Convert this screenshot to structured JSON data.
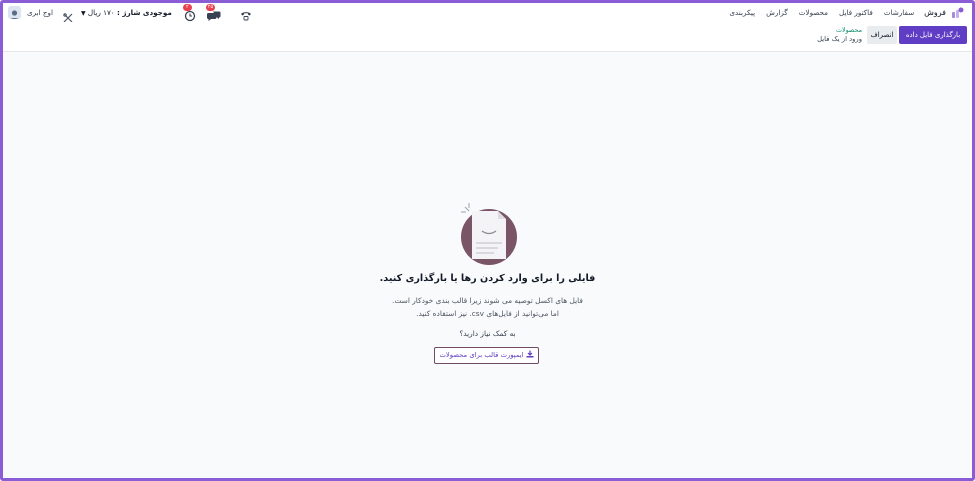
{
  "navbar": {
    "brand": "فروش",
    "menu": [
      "سفارشات",
      "فاکتور فایل",
      "محصولات",
      "گزارش",
      "پیکربندی"
    ],
    "user": {
      "name": "اوج ابری"
    },
    "balance": {
      "label": "موجودی شارژ :",
      "value": "۱۷۰ ریال"
    },
    "chat_badge": "۲۵",
    "activity_badge": "۲"
  },
  "control_panel": {
    "upload_button": "بارگذاری فایل داده",
    "cancel_button": "انصراف",
    "breadcrumb_link": "محصولات",
    "breadcrumb_title": "ورود از یک فایل"
  },
  "empty_state": {
    "title": "فایلی را برای وارد کردن رها یا بارگذاری کنید.",
    "text_line1": "فایل های اکسل توصیه می شوند زیرا قالب بندی خودکار است.",
    "text_line2": "اما می‌توانید از فایل‌های csv. نیز استفاده کنید.",
    "help_text": "به کمک نیاز دارید؟",
    "template_button": "ایمپورت قالب برای محصولات"
  },
  "colors": {
    "primary": "#5f3dc4",
    "brand_purple": "#714b67",
    "accent_green": "#0f8a6b",
    "badge_red": "#e8404f",
    "frame": "#8a5cd6"
  }
}
